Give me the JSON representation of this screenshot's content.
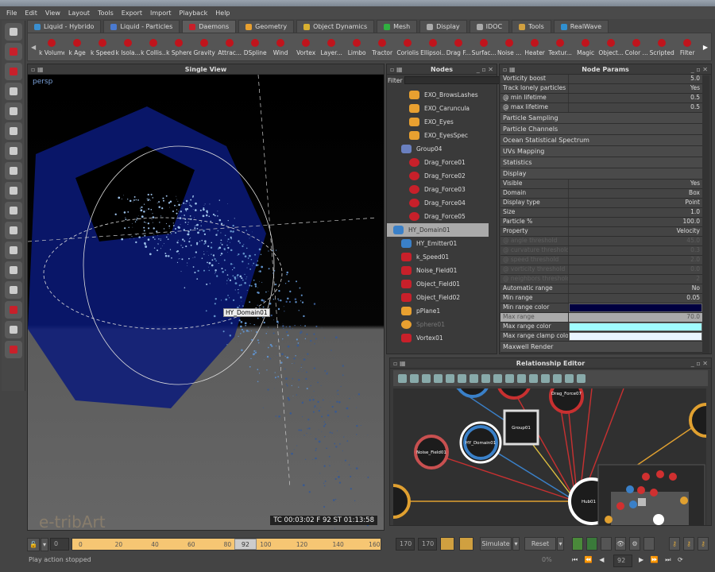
{
  "menu": [
    "File",
    "Edit",
    "View",
    "Layout",
    "Tools",
    "Export",
    "Import",
    "Playback",
    "Help"
  ],
  "tabs": [
    {
      "label": "Liquid - Hybrido",
      "color": "#3a8fd0"
    },
    {
      "label": "Liquid - Particles",
      "color": "#4a7ad0"
    },
    {
      "label": "Daemons",
      "color": "#c8202a",
      "active": true
    },
    {
      "label": "Geometry",
      "color": "#e8a030"
    },
    {
      "label": "Object Dynamics",
      "color": "#d8b030"
    },
    {
      "label": "Mesh",
      "color": "#30b040"
    },
    {
      "label": "Display",
      "color": "#aaaaaa"
    },
    {
      "label": "IDOC",
      "color": "#aaaaaa"
    },
    {
      "label": "Tools",
      "color": "#d0a040"
    },
    {
      "label": "RealWave",
      "color": "#3090d0"
    }
  ],
  "tools": [
    "k Volume",
    "k Age",
    "k Speed",
    "k Isola...",
    "k Collis...",
    "k Sphere",
    "Gravity",
    "Attrac...",
    "DSpline",
    "Wind",
    "Vortex",
    "Layer...",
    "Limbo",
    "Tractor",
    "Coriolis",
    "Ellipsoi...",
    "Drag F...",
    "Surfac...",
    "Noise ...",
    "Heater",
    "Textur...",
    "Magic",
    "Object...",
    "Color ...",
    "Scripted",
    "Filter"
  ],
  "viewport": {
    "title": "Single View",
    "camera": "persp",
    "tooltip": "HY_Domain01",
    "hud": "TC 00:03:02   F 92   ST 01:13:58",
    "watermark": "e-tribArt"
  },
  "nodes": {
    "title": "Nodes",
    "filter_label": "Filter",
    "filter_value": "",
    "items": [
      {
        "label": "EXO_BrowsLashes",
        "icon": "geometry",
        "color": "#e8a030",
        "indent": 2
      },
      {
        "label": "EXO_Caruncula",
        "icon": "geometry",
        "color": "#e8a030",
        "indent": 2
      },
      {
        "label": "EXO_Eyes",
        "icon": "geometry",
        "color": "#e8a030",
        "indent": 2
      },
      {
        "label": "EXO_EyesSpec",
        "icon": "geometry",
        "color": "#e8a030",
        "indent": 2
      },
      {
        "label": "Group04",
        "icon": "group",
        "color": "#6a80c0",
        "indent": 1
      },
      {
        "label": "Drag_Force01",
        "icon": "drag",
        "color": "#c8202a",
        "indent": 2
      },
      {
        "label": "Drag_Force02",
        "icon": "drag",
        "color": "#c8202a",
        "indent": 2
      },
      {
        "label": "Drag_Force03",
        "icon": "drag",
        "color": "#c8202a",
        "indent": 2
      },
      {
        "label": "Drag_Force04",
        "icon": "drag",
        "color": "#c8202a",
        "indent": 2
      },
      {
        "label": "Drag_Force05",
        "icon": "drag",
        "color": "#c8202a",
        "indent": 2
      },
      {
        "label": "HY_Domain01",
        "icon": "domain",
        "color": "#3a80c8",
        "indent": 0,
        "selected": true
      },
      {
        "label": "HY_Emitter01",
        "icon": "emitter",
        "color": "#3a80c8",
        "indent": 1
      },
      {
        "label": "k_Speed01",
        "icon": "speed",
        "color": "#c8202a",
        "indent": 1
      },
      {
        "label": "Noise_Field01",
        "icon": "noise",
        "color": "#c8202a",
        "indent": 1
      },
      {
        "label": "Object_Field01",
        "icon": "object",
        "color": "#c8202a",
        "indent": 1
      },
      {
        "label": "Object_Field02",
        "icon": "object",
        "color": "#c8202a",
        "indent": 1
      },
      {
        "label": "pPlane1",
        "icon": "geometry",
        "color": "#e8a030",
        "indent": 1
      },
      {
        "label": "Sphere01",
        "icon": "sphere",
        "color": "#e8a030",
        "indent": 1,
        "dim": true
      },
      {
        "label": "Vortex01",
        "icon": "vortex",
        "color": "#c8202a",
        "indent": 1
      }
    ]
  },
  "params": {
    "title": "Node Params",
    "top_rows": [
      [
        "Vorticity boost",
        "5.0"
      ],
      [
        "Track lonely particles",
        "Yes"
      ],
      [
        "@ min lifetime",
        "0.5"
      ],
      [
        "@ max lifetime",
        "0.5"
      ]
    ],
    "sections": [
      "Particle Sampling",
      "Particle Channels",
      "Ocean Statistical Spectrum",
      "UVs Mapping",
      "Statistics",
      "Display"
    ],
    "display_rows": [
      {
        "k": "Visible",
        "v": "Yes"
      },
      {
        "k": "Domain",
        "v": "Box"
      },
      {
        "k": "Display type",
        "v": "Point"
      },
      {
        "k": "Size",
        "v": "1.0"
      },
      {
        "k": "Particle %",
        "v": "100.0"
      },
      {
        "k": "Property",
        "v": "Velocity"
      },
      {
        "k": "@ angle threshold",
        "v": "45.0",
        "dis": true
      },
      {
        "k": "@ curvature threshold",
        "v": "0.3",
        "dis": true
      },
      {
        "k": "@ speed threshold",
        "v": "2.0",
        "dis": true
      },
      {
        "k": "@ vorticity threshold",
        "v": "0.0",
        "dis": true
      },
      {
        "k": "@ neighbors threshold",
        "v": "2",
        "dis": true
      },
      {
        "k": "Automatic range",
        "v": "No"
      },
      {
        "k": "Min range",
        "v": "0.05"
      },
      {
        "k": "Min range color",
        "color": "#000040"
      },
      {
        "k": "Max range",
        "v": "70.0",
        "hl": true
      },
      {
        "k": "Max range color",
        "color": "#a0fcff"
      },
      {
        "k": "Max range clamp color",
        "color": "#eaf4ff"
      }
    ],
    "last_section": "Maxwell Render"
  },
  "relationship": {
    "title": "Relationship Editor",
    "nodes": [
      "Drag_Force07",
      "Group01",
      "HY_Domain01",
      "Noise_Field01",
      "Hub01"
    ]
  },
  "timeline": {
    "start": "0",
    "ticks": [
      "0",
      "20",
      "40",
      "60",
      "80",
      "100",
      "120",
      "140",
      "160"
    ],
    "current": "92",
    "current_fraction": 0.541,
    "end1": "170",
    "end2": "170"
  },
  "controls": {
    "simulate": "Simulate",
    "reset": "Reset",
    "progress": "0%",
    "frame": "92"
  },
  "status": "Play action stopped"
}
